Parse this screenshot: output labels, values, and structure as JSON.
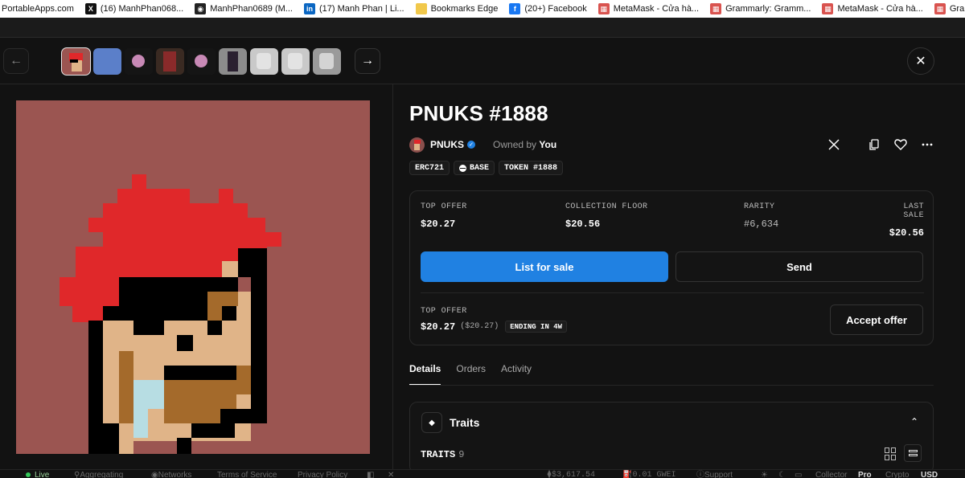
{
  "bookmarks": [
    {
      "label": "PortableApps.com",
      "icon": "portableapps-icon",
      "color": "#cc2222"
    },
    {
      "label": "(16) ManhPhan068...",
      "icon": "x-logo-icon",
      "color": "#111111"
    },
    {
      "label": "ManhPhan0689 (M...",
      "icon": "github-icon",
      "color": "#222222"
    },
    {
      "label": "(17) Manh Phan | Li...",
      "icon": "linkedin-icon",
      "color": "#0a66c2"
    },
    {
      "label": "Bookmarks Edge",
      "icon": "folder-icon",
      "color": "#f1c84b"
    },
    {
      "label": "(20+) Facebook",
      "icon": "facebook-icon",
      "color": "#1877f2"
    },
    {
      "label": "MetaMask - Cửa hà...",
      "icon": "chrome-webstore-icon",
      "color": "#d9534f"
    },
    {
      "label": "Grammarly: Gramm...",
      "icon": "chrome-webstore-icon",
      "color": "#d9534f"
    },
    {
      "label": "MetaMask - Cửa hà...",
      "icon": "chrome-webstore-icon",
      "color": "#d9534f"
    },
    {
      "label": "Grammarly: Gramm...",
      "icon": "chrome-webstore-icon",
      "color": "#d9534f"
    }
  ],
  "nav": {
    "prev_icon": "←",
    "next_icon": "→",
    "close_icon": "✕"
  },
  "item": {
    "title": "PNUKS #1888",
    "collection": "PNUKS",
    "owned_by_label": "Owned by",
    "owner": "You",
    "tags": [
      {
        "label": "ERC721",
        "icon": ""
      },
      {
        "label": "BASE",
        "icon": "base-chain-icon"
      },
      {
        "label": "TOKEN #1888",
        "icon": ""
      }
    ]
  },
  "stats": [
    {
      "label": "TOP OFFER",
      "value": "$20.27"
    },
    {
      "label": "COLLECTION FLOOR",
      "value": "$20.56"
    },
    {
      "label": "RARITY",
      "value": "#6,634"
    },
    {
      "label": "LAST SALE",
      "value": "$20.56"
    }
  ],
  "buttons": {
    "list": "List for sale",
    "send": "Send",
    "accept": "Accept offer"
  },
  "top_offer": {
    "label": "TOP OFFER",
    "value": "$20.27",
    "usd": "($20.27)",
    "ending": "ENDING IN 4W"
  },
  "tabs": [
    {
      "label": "Details",
      "active": true
    },
    {
      "label": "Orders",
      "active": false
    },
    {
      "label": "Activity",
      "active": false
    }
  ],
  "traits": {
    "title": "Traits",
    "count_label": "TRAITS",
    "count": "9"
  },
  "footer": {
    "live": "Live",
    "aggregating": "Aggregating",
    "networks": "Networks",
    "terms": "Terms of Service",
    "privacy": "Privacy Policy",
    "eth_price": "$3,617.54",
    "gas": "0.01 GWEI",
    "support": "Support",
    "collector": "Collector",
    "pro": "Pro",
    "crypto": "Crypto",
    "currency": "USD"
  },
  "colors": {
    "accent": "#2081e2",
    "nft_background": "#9b5551",
    "hair": "#e0282a",
    "skin": "#e0b488",
    "shadow": "#a46a2b"
  }
}
